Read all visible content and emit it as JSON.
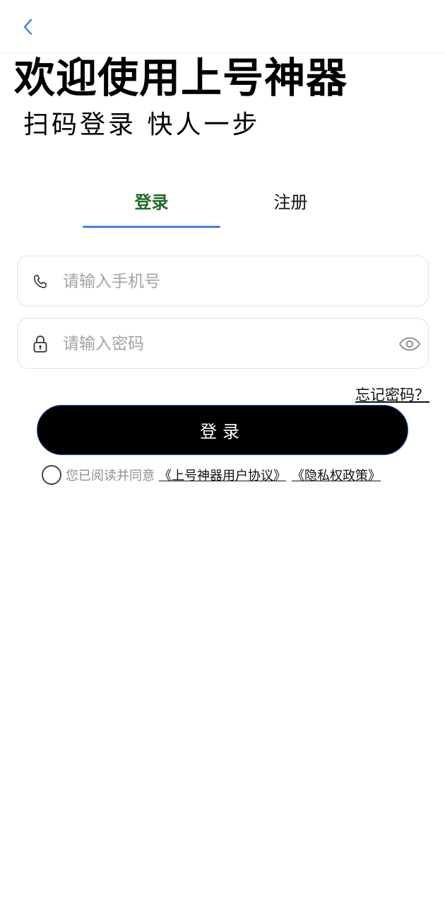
{
  "header": {
    "back_icon": "chevron-left-icon",
    "accent_color": "#3c7fd6"
  },
  "hero": {
    "title": "欢迎使用上号神器",
    "subtitle": "扫码登录 快人一步"
  },
  "tabs": [
    {
      "label": "登录",
      "active": true,
      "color": "#1e6b25"
    },
    {
      "label": "注册",
      "active": false
    }
  ],
  "form": {
    "phone": {
      "placeholder": "请输入手机号",
      "value": "",
      "icon": "phone-icon"
    },
    "password": {
      "placeholder": "请输入密码",
      "value": "",
      "icon": "lock-icon",
      "toggle_icon": "eye-icon"
    },
    "forgot_label": "忘记密码？",
    "submit_label": "登录"
  },
  "agreement": {
    "checked": false,
    "text": "您已阅读并同意",
    "user_agreement": "《上号神器用户协议》",
    "privacy_policy": "《隐私权政策》"
  }
}
